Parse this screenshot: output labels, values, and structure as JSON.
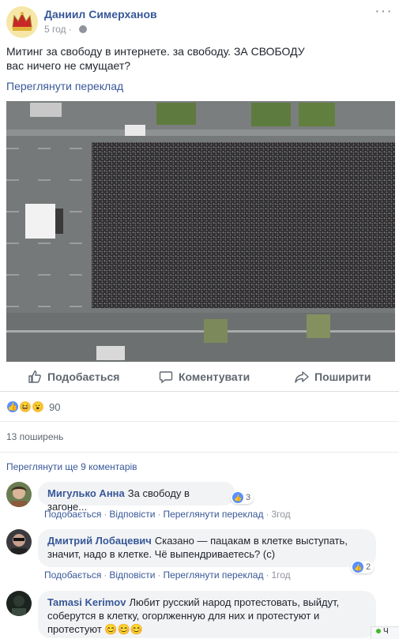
{
  "post": {
    "author": "Даниил Симерханов",
    "time": "5 год",
    "time_separator": "·",
    "text_line1": "Митинг за свободу в интернете. за свободу. ЗА СВОБОДУ",
    "text_line2": "вас ничего не смущает?",
    "see_translation": "Переглянути переклад",
    "more_icon": "ellipsis-icon",
    "photo_icon": "aerial-crowd-photo"
  },
  "actions": {
    "like": "Подобається",
    "comment": "Коментувати",
    "share": "Поширити"
  },
  "reactions": {
    "icons": [
      "like",
      "haha",
      "wow"
    ],
    "count": "90",
    "shares": "13 поширень"
  },
  "comments": {
    "view_more": "Переглянути ще 9 коментарів",
    "items": [
      {
        "name": "Мигулько Анна",
        "text": "За свободу в загоне...",
        "likes": "3",
        "like": "Подобається",
        "reply": "Відповісти",
        "translate": "Переглянути переклад",
        "time": "3год"
      },
      {
        "name": "Дмитрий Лобацевич",
        "text_line1": "Сказано — пацакам в клетке выступать,",
        "text_line2": "значит, надо в клетке. Чё выпендриваетесь? (с)",
        "likes": "2",
        "like": "Подобається",
        "reply": "Відповісти",
        "translate": "Переглянути переклад",
        "time": "1год"
      },
      {
        "name": "Tamasi Kerimov",
        "text_line1": "Любит русский народ протестовать, выйдут,",
        "text_line2": "соберутся в клетку, огорлженную для них и протестуют и",
        "text_line3": "протестуют",
        "emoji": "😊😊😊"
      }
    ]
  },
  "chat": {
    "label": "Ч"
  },
  "colors": {
    "link": "#385898",
    "muted": "#90949c",
    "like_blue": "#5890ff",
    "bubble": "#f2f3f5"
  }
}
